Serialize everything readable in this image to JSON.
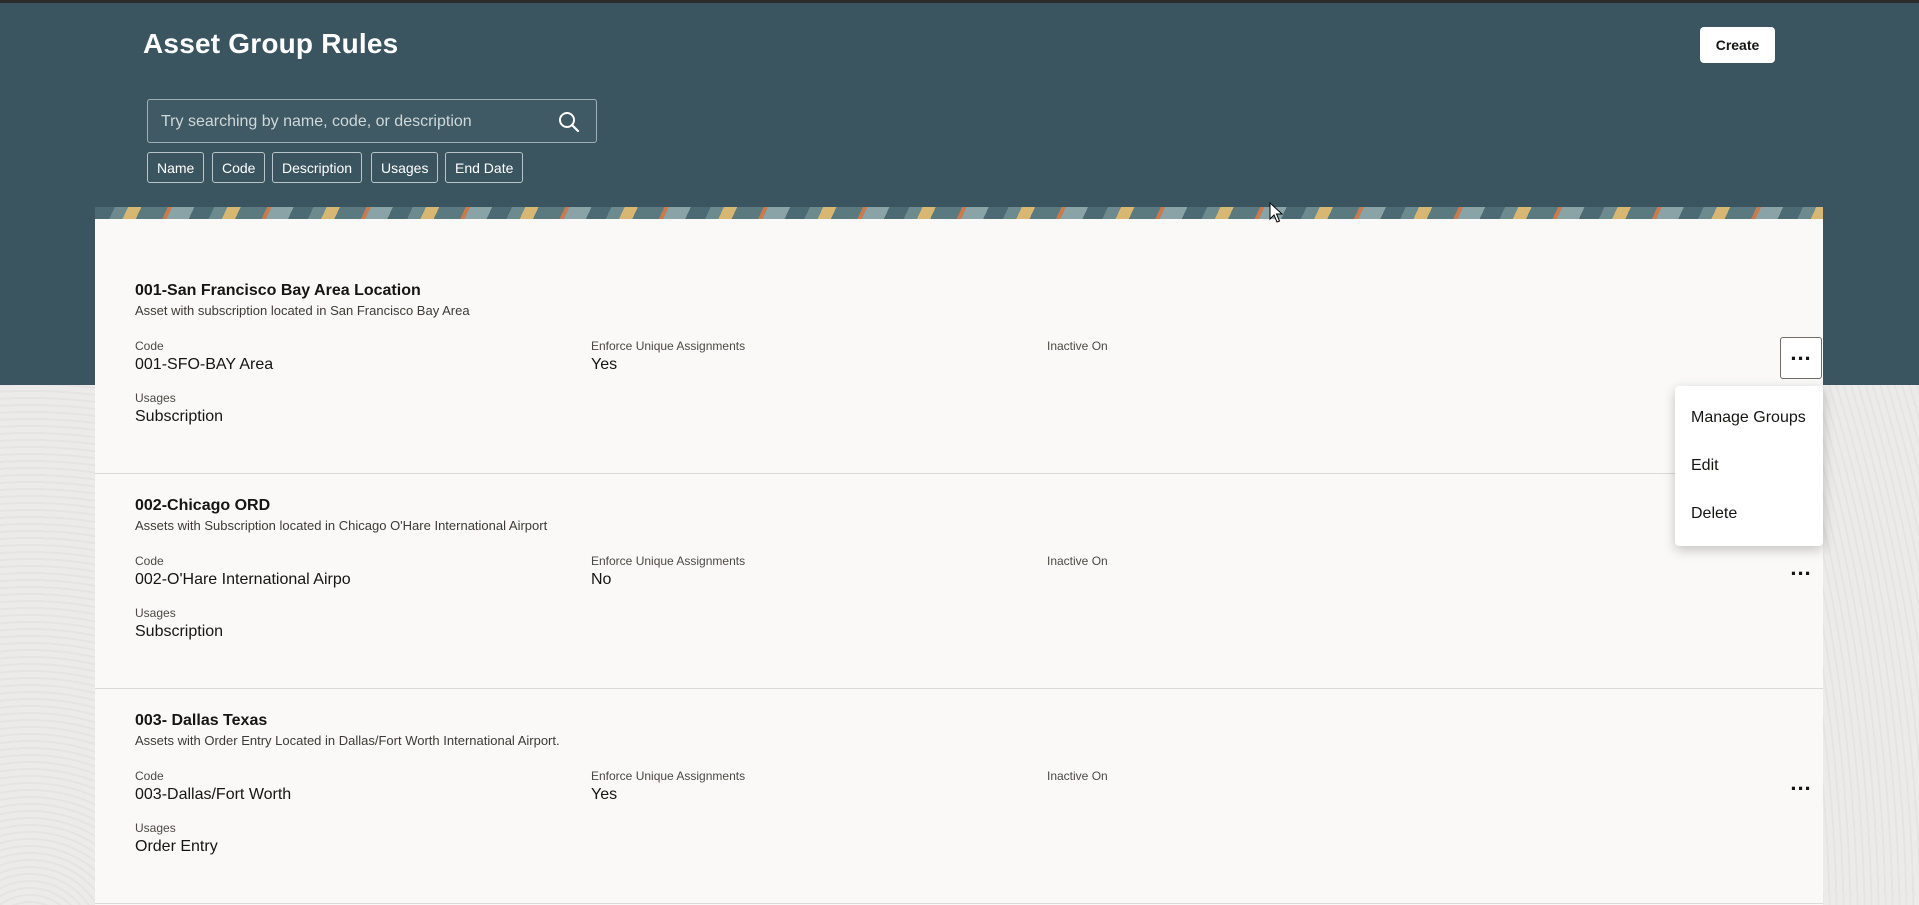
{
  "header": {
    "title": "Asset Group Rules",
    "create_label": "Create",
    "search_placeholder": "Try searching by name, code, or description",
    "filters": [
      "Name",
      "Code",
      "Description",
      "Usages",
      "End Date"
    ]
  },
  "labels": {
    "code": "Code",
    "enforce": "Enforce Unique Assignments",
    "inactive": "Inactive On",
    "usages": "Usages"
  },
  "more_label": "...",
  "rules": [
    {
      "title": "001-San Francisco Bay Area Location",
      "description": "Asset with subscription located in San Francisco Bay Area",
      "code": "001-SFO-BAY Area",
      "enforce_unique": "Yes",
      "inactive_on": "",
      "usages": "Subscription"
    },
    {
      "title": "002-Chicago ORD",
      "description": "Assets with Subscription located in Chicago O'Hare International Airport",
      "code": "002-O'Hare International Airpo",
      "enforce_unique": "No",
      "inactive_on": "",
      "usages": "Subscription"
    },
    {
      "title": "003- Dallas Texas",
      "description": "Assets with Order Entry Located in Dallas/Fort Worth International Airport.",
      "code": "003-Dallas/Fort Worth",
      "enforce_unique": "Yes",
      "inactive_on": "",
      "usages": "Order Entry"
    }
  ],
  "menu": {
    "items": [
      "Manage Groups",
      "Edit",
      "Delete"
    ]
  },
  "icons": {
    "search": "search-icon",
    "more": "more-actions-icon",
    "cursor": "mouse-cursor-icon"
  },
  "colors": {
    "header_bg": "#3a555f",
    "panel_bg": "#faf9f7",
    "page_bg": "#ecebe9"
  }
}
